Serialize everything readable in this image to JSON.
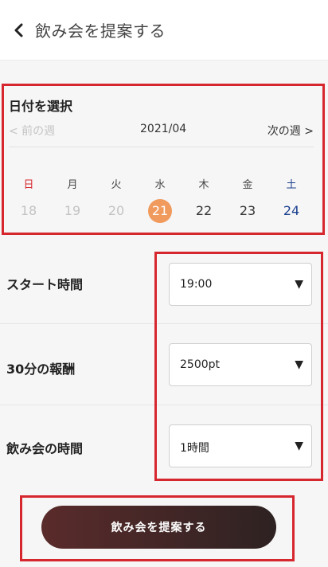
{
  "header": {
    "title": "飲み会を提案する"
  },
  "calendar": {
    "title": "日付を選択",
    "prev_week": "< 前の週",
    "next_week": "次の週 >",
    "month": "2021/04",
    "weekdays": [
      "日",
      "月",
      "火",
      "水",
      "木",
      "金",
      "土"
    ],
    "days": [
      "18",
      "19",
      "20",
      "21",
      "22",
      "23",
      "24"
    ],
    "selected_day": "21",
    "colors": {
      "sunday": "#d6262e",
      "saturday": "#1a3f8f",
      "selected": "#f09a5d",
      "past": "#c3c3c3"
    }
  },
  "form": {
    "start_time": {
      "label": "スタート時間",
      "value": "19:00"
    },
    "reward": {
      "label": "30分の報酬",
      "value": "2500pt"
    },
    "duration": {
      "label": "飲み会の時間",
      "value": "1時間"
    }
  },
  "submit": {
    "label": "飲み会を提案する"
  },
  "icons": {
    "back": "chevron-left-icon",
    "dropdown": "triangle-down-icon"
  },
  "annotation_color": "#d6262e"
}
